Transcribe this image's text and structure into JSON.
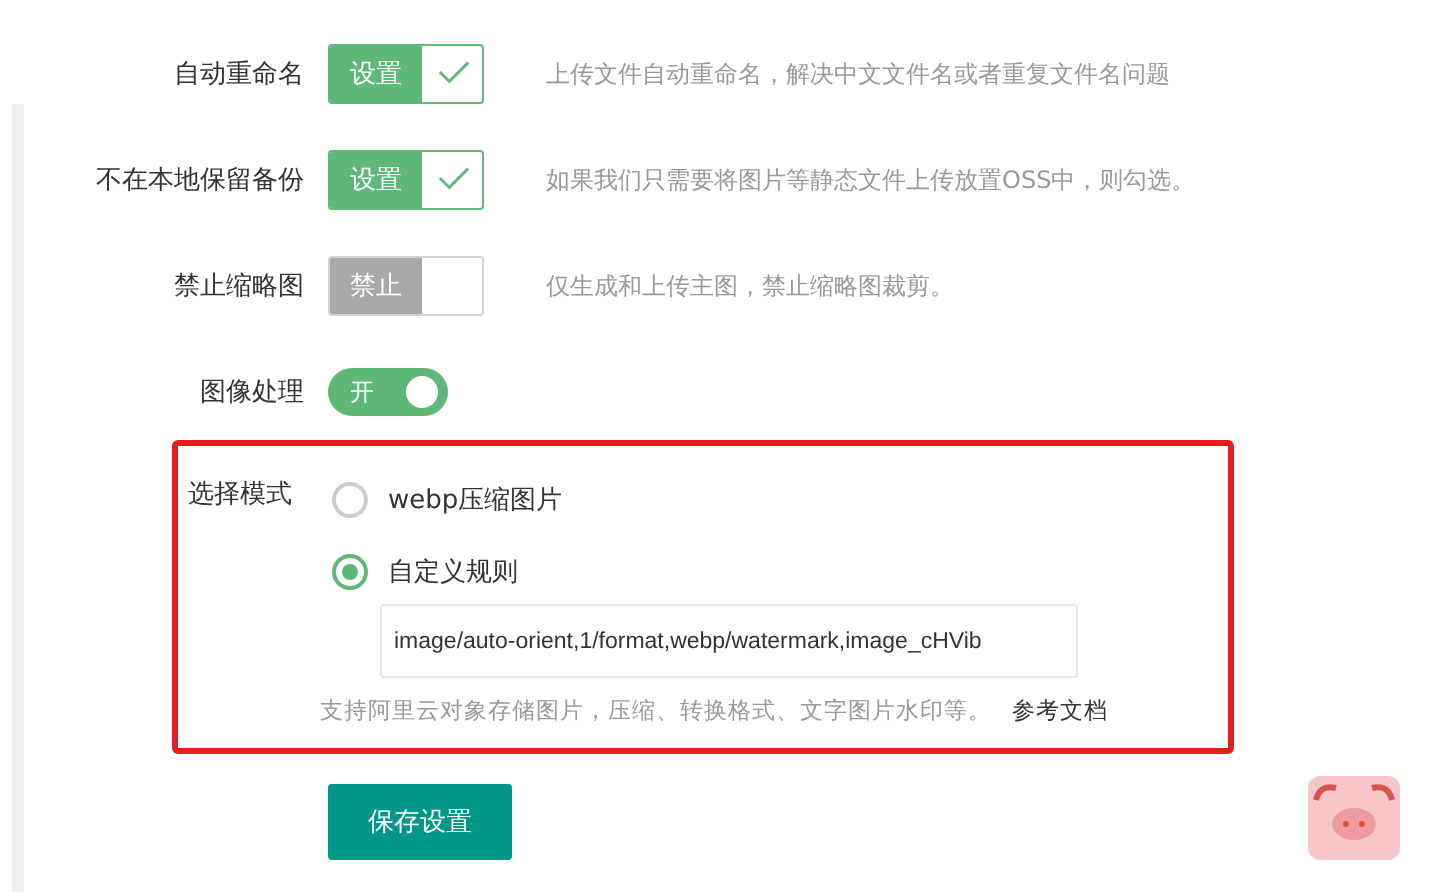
{
  "settings": [
    {
      "kind": "check",
      "label": "自动重命名",
      "button": "设置",
      "checked": true,
      "description": "上传文件自动重命名，解决中文文件名或者重复文件名问题"
    },
    {
      "kind": "check",
      "label": "不在本地保留备份",
      "button": "设置",
      "checked": true,
      "description": "如果我们只需要将图片等静态文件上传放置OSS中，则勾选。"
    },
    {
      "kind": "check",
      "label": "禁止缩略图",
      "button": "禁止",
      "checked": false,
      "description": "仅生成和上传主图，禁止缩略图裁剪。"
    },
    {
      "kind": "switch",
      "label": "图像处理",
      "button": "开",
      "on": true
    }
  ],
  "mode": {
    "label": "选择模式",
    "options": [
      {
        "label": "webp压缩图片",
        "selected": false
      },
      {
        "label": "自定义规则",
        "selected": true
      }
    ],
    "rule_value": "image/auto-orient,1/format,webp/watermark,image_cHVib",
    "help": "支持阿里云对象存储图片，压缩、转换格式、文字图片水印等。",
    "help_link": "参考文档"
  },
  "save_button": "保存设置"
}
